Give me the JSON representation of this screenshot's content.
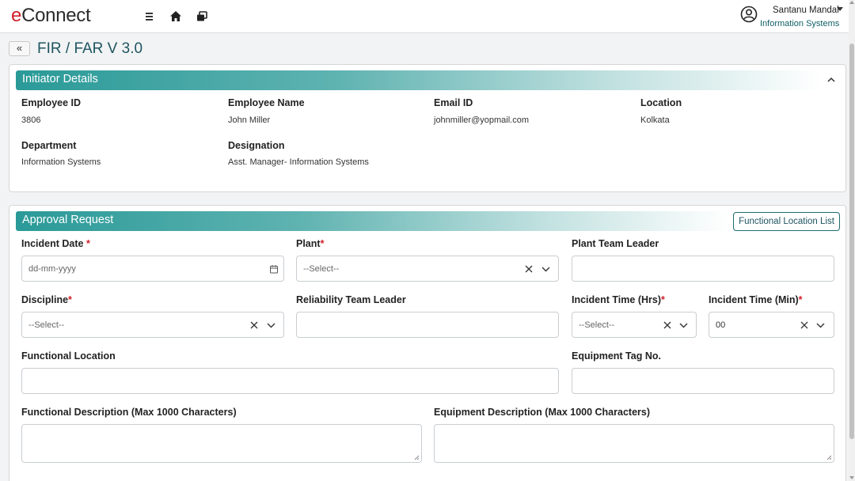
{
  "header": {
    "logo_e": "e",
    "logo_rest": "Connect",
    "user_name": "Santanu Mandal",
    "user_dept": "Information Systems"
  },
  "page": {
    "back_label": "«",
    "title": "FIR / FAR V 3.0"
  },
  "initiator": {
    "section_title": "Initiator Details",
    "fields": [
      {
        "label": "Employee ID",
        "value": "3806"
      },
      {
        "label": "Employee Name",
        "value": "John Miller"
      },
      {
        "label": "Email ID",
        "value": "johnmiller@yopmail.com"
      },
      {
        "label": "Location",
        "value": "Kolkata"
      },
      {
        "label": "Department",
        "value": "Information Systems"
      },
      {
        "label": "Designation",
        "value": "Asst. Manager- Information Systems"
      }
    ]
  },
  "approval": {
    "section_title": "Approval Request",
    "functional_location_list_label": "Functional Location List",
    "required_mark": "*",
    "incident_date": {
      "label": "Incident Date ",
      "placeholder": "dd-mm-yyyy"
    },
    "plant": {
      "label": "Plant",
      "value": "--Select--"
    },
    "plant_team_leader": {
      "label": "Plant Team Leader",
      "value": ""
    },
    "discipline": {
      "label": "Discipline",
      "value": "--Select--"
    },
    "reliability_team_leader": {
      "label": "Reliability Team Leader",
      "value": ""
    },
    "incident_time_hrs": {
      "label": "Incident Time (Hrs)",
      "value": "--Select--"
    },
    "incident_time_min": {
      "label": "Incident Time (Min)",
      "value": "00"
    },
    "functional_location": {
      "label": "Functional Location",
      "value": ""
    },
    "equipment_tag_no": {
      "label": "Equipment Tag No.",
      "value": ""
    },
    "functional_description": {
      "label": "Functional Description (Max 1000 Characters)",
      "value": ""
    },
    "equipment_description": {
      "label": "Equipment Description (Max 1000 Characters)",
      "value": ""
    }
  }
}
